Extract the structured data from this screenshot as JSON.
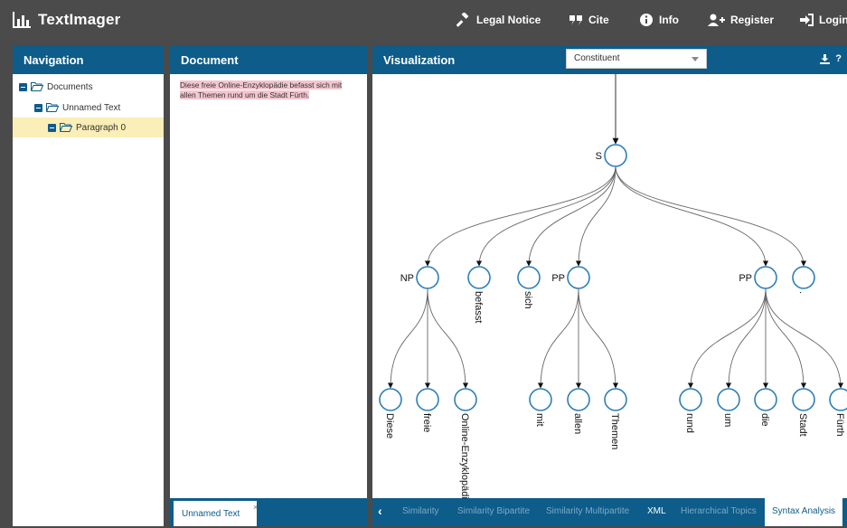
{
  "app": {
    "title": "TextImager",
    "nav": [
      {
        "label": "Legal Notice",
        "icon": "gavel-icon"
      },
      {
        "label": "Cite",
        "icon": "quote-icon"
      },
      {
        "label": "Info",
        "icon": "info-icon"
      },
      {
        "label": "Register",
        "icon": "user-plus-icon"
      },
      {
        "label": "Login",
        "icon": "sign-in-icon"
      }
    ]
  },
  "navigation": {
    "title": "Navigation",
    "tree": [
      {
        "label": "Documents",
        "level": 0
      },
      {
        "label": "Unnamed Text",
        "level": 1
      },
      {
        "label": "Paragraph 0",
        "level": 2,
        "selected": true
      }
    ]
  },
  "document": {
    "title": "Document",
    "text": "Diese freie Online-Enzyklopädie befasst sich mit allen Themen rund um die Stadt Fürth.",
    "tab_label": "Unnamed Text",
    "tab_close": "×"
  },
  "visualization": {
    "title": "Visualization",
    "select_value": "Constituent",
    "tools": [
      "download-icon",
      "help-icon"
    ],
    "help_label": "?",
    "nav_left": "‹",
    "tabs": [
      "Similarity",
      "Similarity Bipartite",
      "Similarity Multipartite",
      "XML",
      "Hierarchical Topics",
      "Syntax Analysis"
    ],
    "active_tab": "Syntax Analysis"
  },
  "colors": {
    "topbar": "#4b4b4b",
    "panel_header": "#0d5c8a",
    "node_stroke": "#2c7fb8",
    "highlight": "#f4c6cf",
    "selected_row": "#fbeeb6"
  },
  "syntax_tree": {
    "root": "S",
    "phrases": [
      "NP",
      "PP",
      "PP"
    ],
    "words": [
      "befasst",
      "sich",
      "."
    ],
    "leaves": [
      "Diese",
      "freie",
      "Online-Enzyklopädie",
      "mit",
      "allen",
      "Themen",
      "rund",
      "um",
      "die",
      "Stadt",
      "Fürth"
    ]
  }
}
